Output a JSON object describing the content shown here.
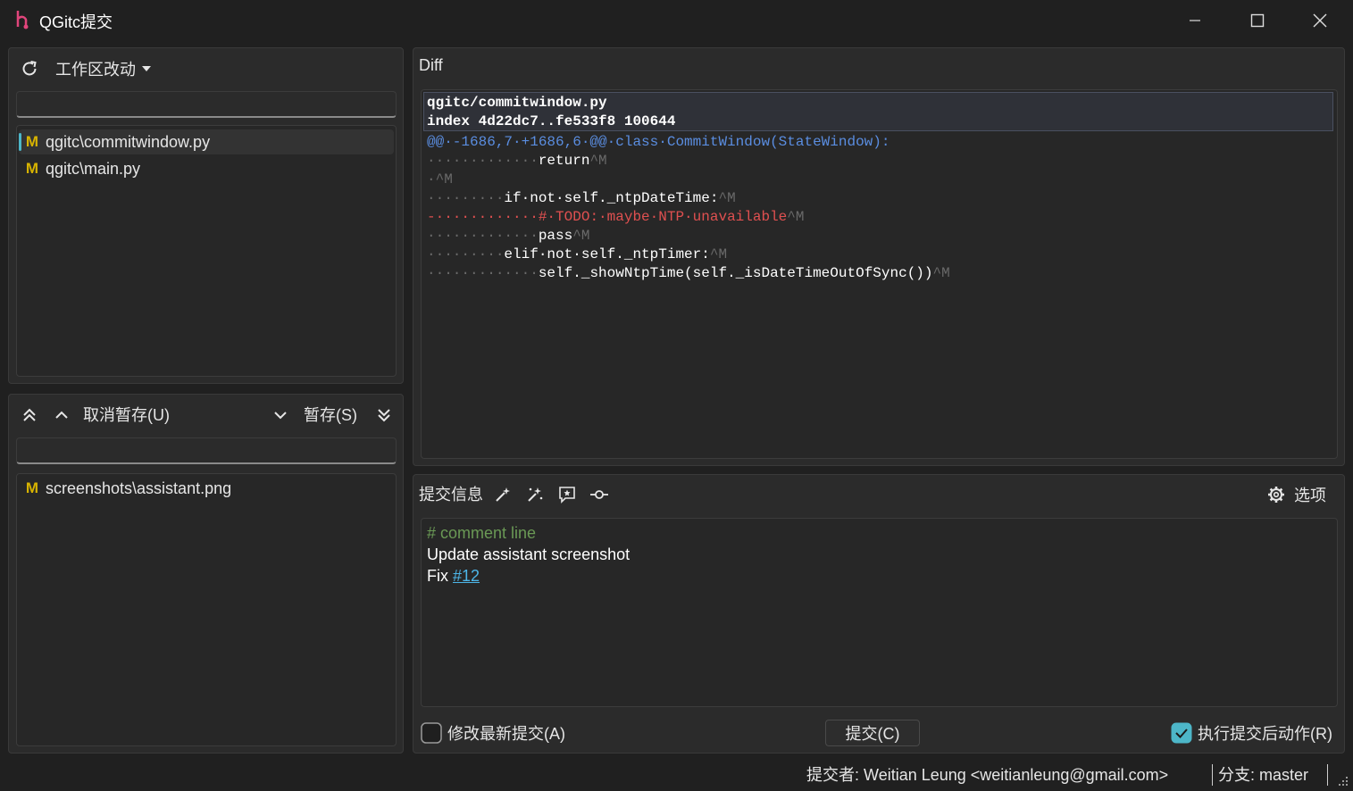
{
  "window": {
    "title": "QGitc提交"
  },
  "workspace": {
    "dropdown_label": "工作区改动",
    "files": [
      {
        "badge": "M",
        "name": "qgitc\\commitwindow.py"
      },
      {
        "badge": "M",
        "name": "qgitc\\main.py"
      }
    ]
  },
  "stage_toolbar": {
    "unstage_label": "取消暂存(U)",
    "stage_label": "暂存(S)"
  },
  "staged": {
    "files": [
      {
        "badge": "M",
        "name": "screenshots\\assistant.png"
      }
    ]
  },
  "diff": {
    "title": "Diff",
    "header_lines": [
      "qgitc/commitwindow.py",
      "index 4d22dc7..fe533f8 100644"
    ],
    "lines": [
      {
        "kind": "hunk",
        "text": "@@·-1686,7·+1686,6·@@·class·CommitWindow(StateWindow):"
      },
      {
        "kind": "ctx",
        "indent": "·············",
        "text": "return",
        "suffix": "^M"
      },
      {
        "kind": "ctx",
        "indent": "·",
        "text": "",
        "suffix": "^M"
      },
      {
        "kind": "ctx",
        "indent": "·········",
        "text": "if·not·self._ntpDateTime:",
        "suffix": "^M"
      },
      {
        "kind": "del",
        "indent": "-············",
        "text": "#·TODO:·maybe·NTP·unavailable",
        "suffix": "^M"
      },
      {
        "kind": "ctx",
        "indent": "·············",
        "text": "pass",
        "suffix": "^M"
      },
      {
        "kind": "ctx",
        "indent": "·········",
        "text": "elif·not·self._ntpTimer:",
        "suffix": "^M"
      },
      {
        "kind": "ctx",
        "indent": "·············",
        "text": "self._showNtpTime(self._isDateTimeOutOfSync())",
        "suffix": "^M"
      }
    ]
  },
  "commit": {
    "title": "提交信息",
    "options_label": "选项",
    "message": {
      "comment": "# comment line",
      "line1": "Update assistant screenshot",
      "line3_prefix": "Fix ",
      "line3_link": "#12"
    },
    "amend_label": "修改最新提交(A)",
    "amend_checked": false,
    "commit_button": "提交(C)",
    "post_action_label": "执行提交后动作(R)",
    "post_action_checked": true
  },
  "status": {
    "committer_label": "提交者:",
    "committer": "Weitian Leung <weitianleung@gmail.com>",
    "branch_label": "分支:",
    "branch": "master"
  },
  "colors": {
    "background": "#202020",
    "panel": "#2b2b2b",
    "accent": "#4db6c8",
    "modified_badge": "#d7b300",
    "hunk": "#5a8de0",
    "deleted": "#e05050",
    "comment": "#6a9955",
    "link": "#4db6e8"
  },
  "icons": {
    "app": "qgitc-logo-icon",
    "refresh": "refresh-icon",
    "caret": "caret-down-icon",
    "unstage_all": "double-chevron-up-icon",
    "unstage": "chevron-up-icon",
    "stage": "chevron-down-icon",
    "stage_all": "double-chevron-down-icon",
    "ai_generate": "magic-wand-icon",
    "ai_refine": "sparkle-wand-icon",
    "code_review": "review-comment-icon",
    "commit_graph": "commit-node-icon",
    "settings": "gear-icon"
  }
}
